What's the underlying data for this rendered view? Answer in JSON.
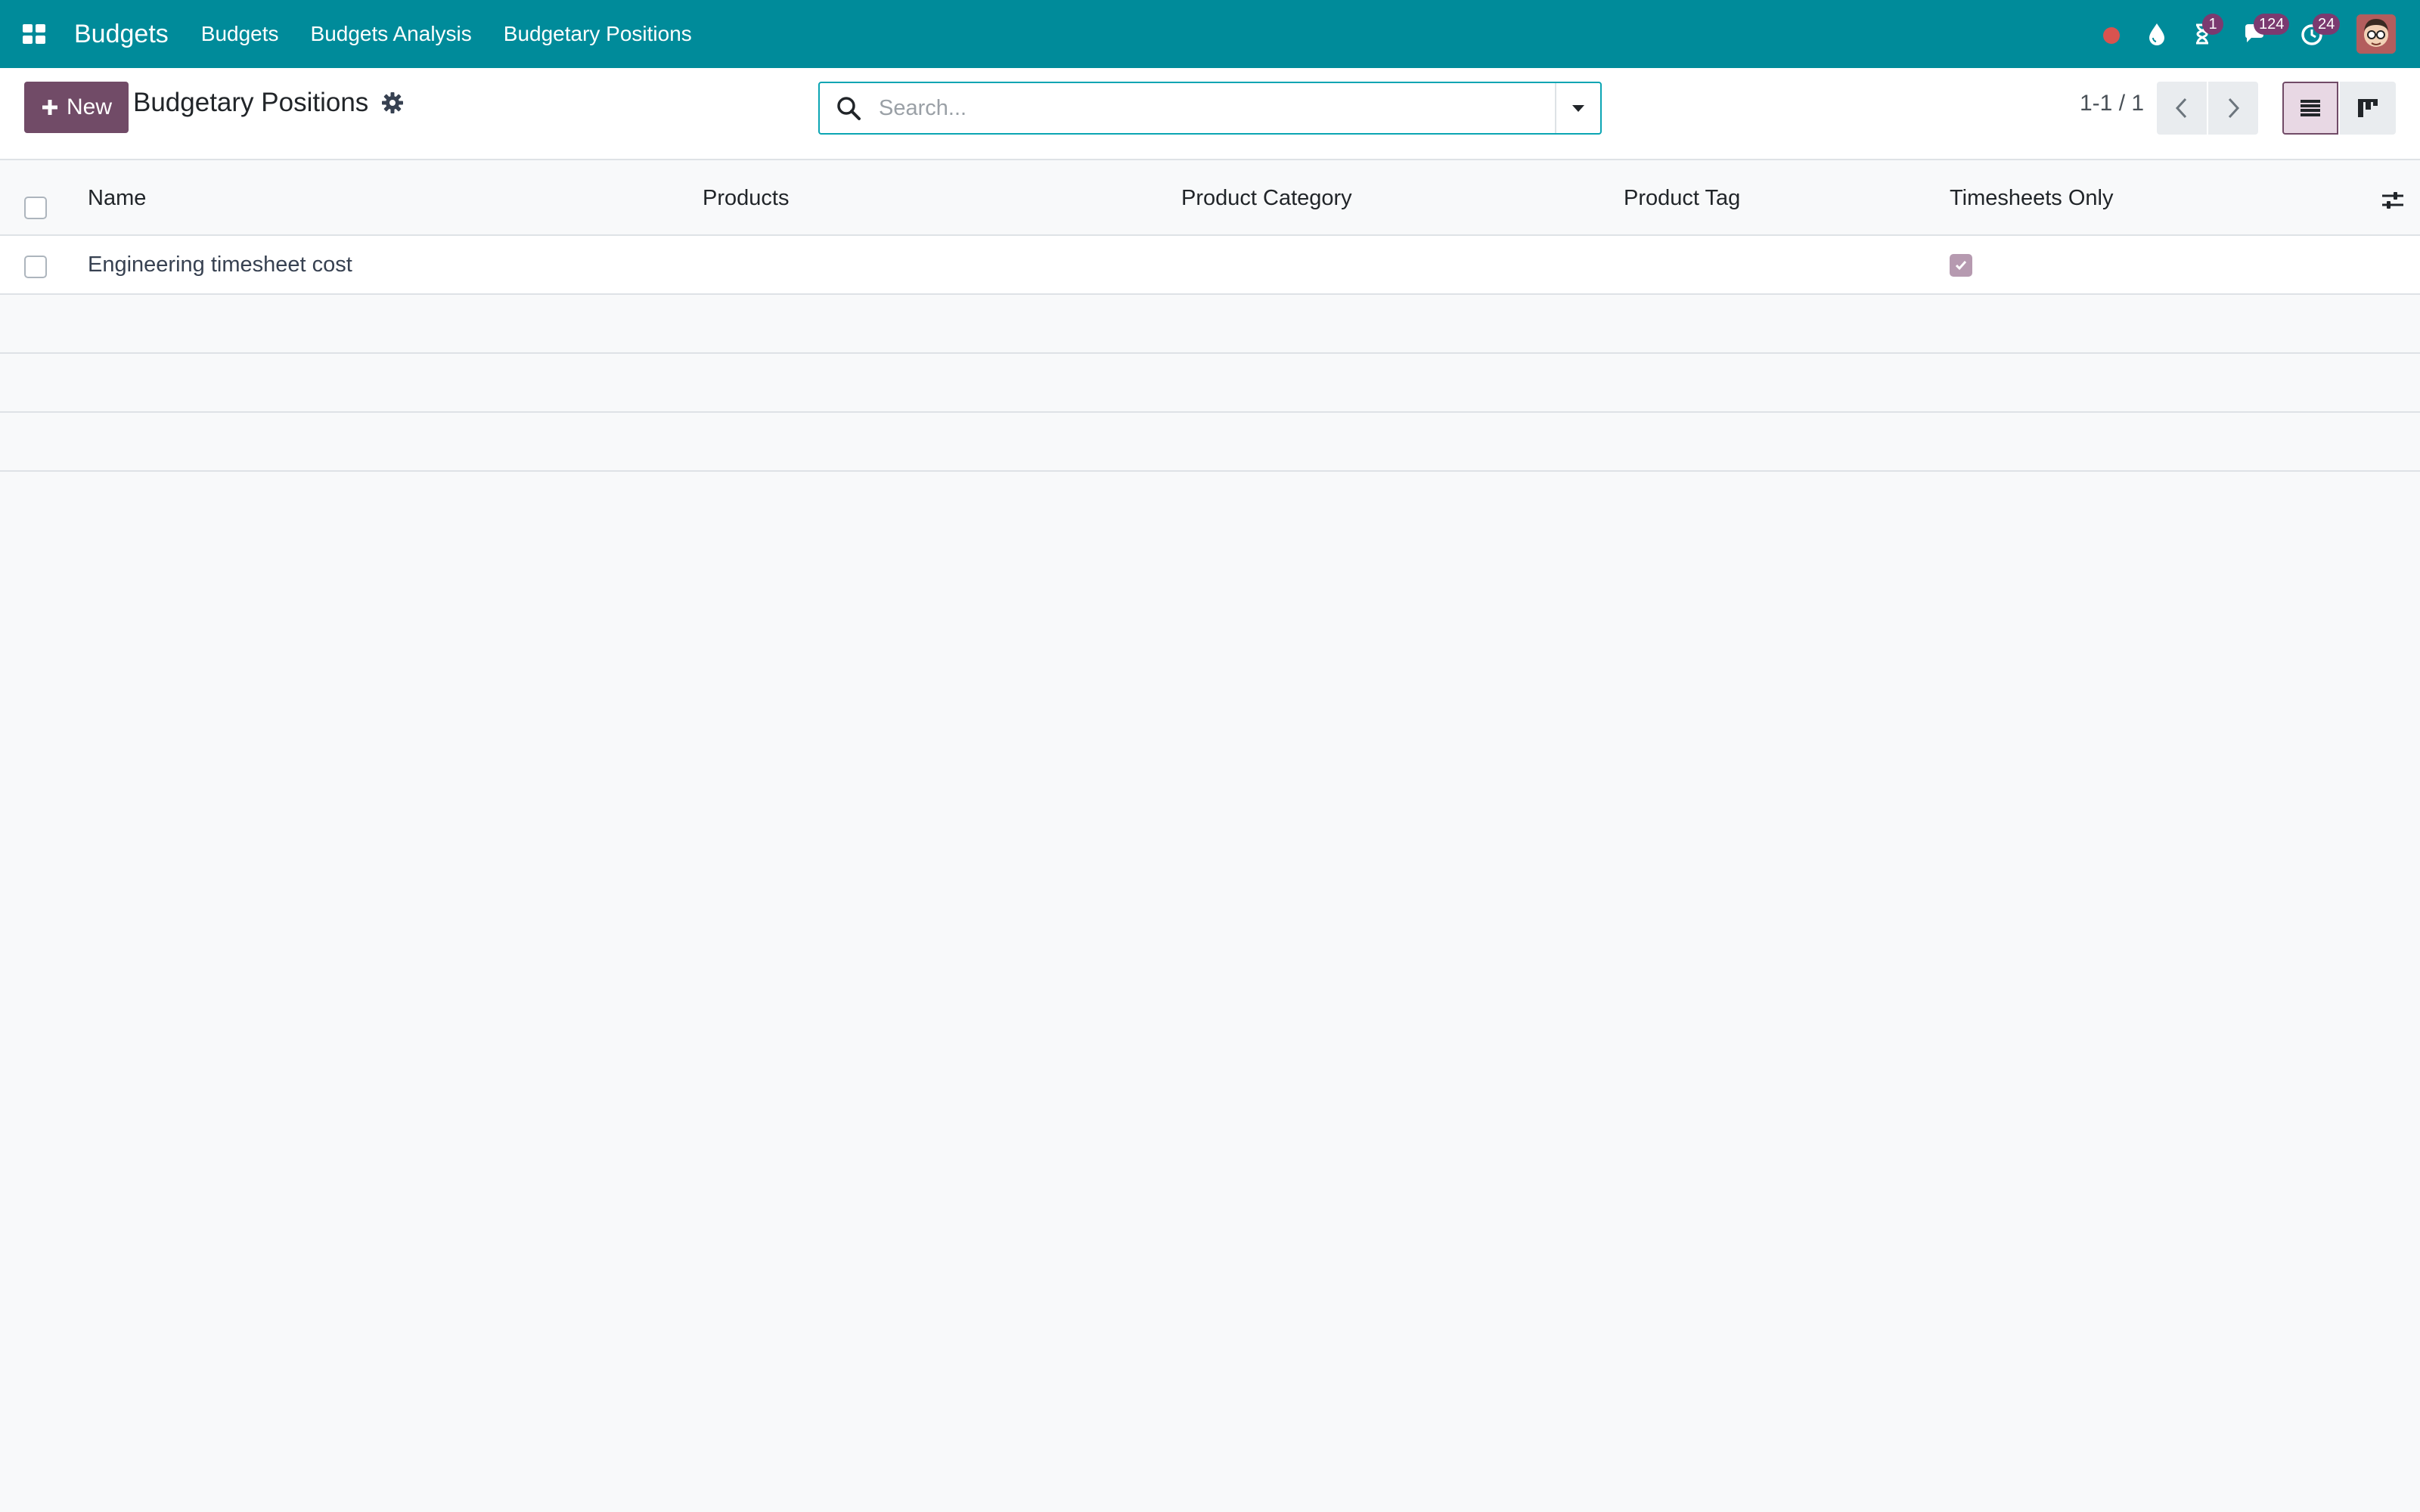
{
  "navbar": {
    "brand": "Budgets",
    "menu": [
      {
        "label": "Budgets"
      },
      {
        "label": "Budgets Analysis"
      },
      {
        "label": "Budgetary Positions"
      }
    ],
    "systray": {
      "activity_badge": "1",
      "messages_badge": "124",
      "updates_badge": "24"
    },
    "colors": {
      "navbar": "#008b9a",
      "badge": "#7b3a70",
      "record_dot": "#d9534f"
    }
  },
  "control_panel": {
    "new_button": "New",
    "breadcrumb": "Budgetary Positions",
    "search": {
      "placeholder": "Search...",
      "value": ""
    },
    "pager": "1-1 / 1",
    "accent_color": "#714b67"
  },
  "table": {
    "columns": [
      "Name",
      "Products",
      "Product Category",
      "Product Tag",
      "Timesheets Only"
    ],
    "rows": [
      {
        "name": "Engineering timesheet cost",
        "products": "",
        "product_category": "",
        "product_tag": "",
        "timesheets_only": true
      }
    ]
  }
}
